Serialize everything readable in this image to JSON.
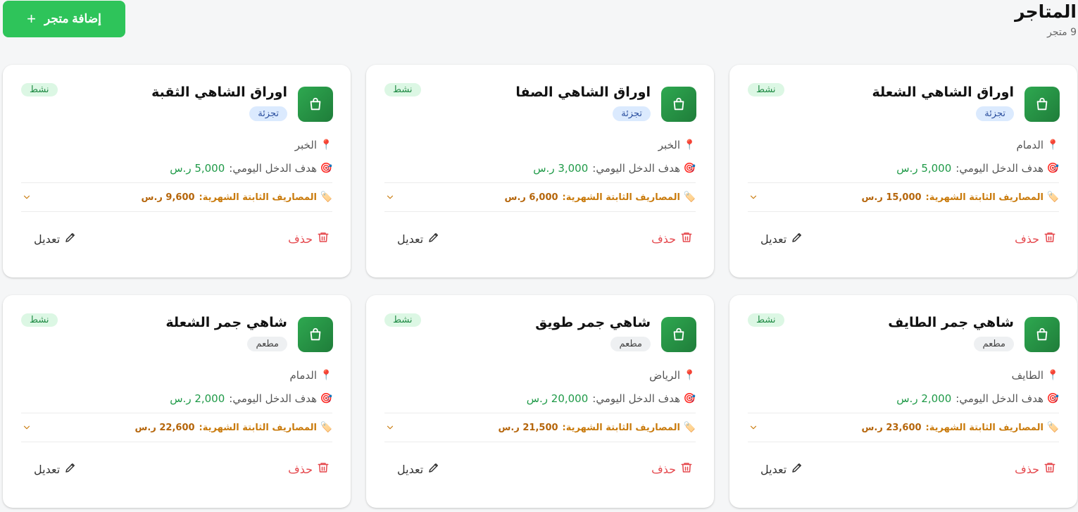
{
  "header": {
    "title": "المتاجر",
    "subtitle": "9 متجر",
    "add_button": "إضافة متجر",
    "add_icon": "+"
  },
  "labels": {
    "daily_target": "هدف الدخل اليومي:",
    "monthly_expenses": "المصاريف الثابتة الشهرية:",
    "delete": "حذف",
    "edit": "تعديل",
    "pin_emoji": "📍",
    "target_emoji": "🎯",
    "tag_emoji": "🏷️"
  },
  "colors": {
    "accent_green": "#2ec45a",
    "target_green": "#1f9a48",
    "expense_orange": "#c97a0b",
    "delete_red": "#e5484d"
  },
  "stores": [
    {
      "name": "اوراق الشاهي الشعلة",
      "type": "تجزئة",
      "type_kind": "retail",
      "status": "نشط",
      "city": "الدمام",
      "daily_target": "5,000 ر.س",
      "monthly_expenses": "15,000 ر.س"
    },
    {
      "name": "اوراق الشاهي الصفا",
      "type": "تجزئة",
      "type_kind": "retail",
      "status": "نشط",
      "city": "الخبر",
      "daily_target": "3,000 ر.س",
      "monthly_expenses": "6,000 ر.س"
    },
    {
      "name": "اوراق الشاهي الثقبة",
      "type": "تجزئة",
      "type_kind": "retail",
      "status": "نشط",
      "city": "الخبر",
      "daily_target": "5,000 ر.س",
      "monthly_expenses": "9,600 ر.س"
    },
    {
      "name": "شاهي جمر الطايف",
      "type": "مطعم",
      "type_kind": "restaurant",
      "status": "نشط",
      "city": "الطايف",
      "daily_target": "2,000 ر.س",
      "monthly_expenses": "23,600 ر.س"
    },
    {
      "name": "شاهي جمر طويق",
      "type": "مطعم",
      "type_kind": "restaurant",
      "status": "نشط",
      "city": "الرياض",
      "daily_target": "20,000 ر.س",
      "monthly_expenses": "21,500 ر.س"
    },
    {
      "name": "شاهي جمر الشعلة",
      "type": "مطعم",
      "type_kind": "restaurant",
      "status": "نشط",
      "city": "الدمام",
      "daily_target": "2,000 ر.س",
      "monthly_expenses": "22,600 ر.س"
    }
  ]
}
